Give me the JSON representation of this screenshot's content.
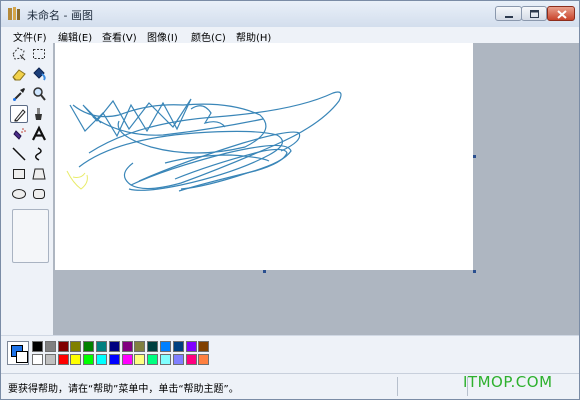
{
  "window": {
    "title": "未命名 - 画图",
    "controls": [
      "minimize-icon",
      "maximize-icon",
      "close-icon"
    ]
  },
  "menu": {
    "items": [
      "文件(F)",
      "编辑(E)",
      "查看(V)",
      "图像(I)",
      "颜色(C)",
      "帮助(H)"
    ]
  },
  "tools": [
    "free-form-select-icon",
    "select-icon",
    "eraser-icon",
    "fill-icon",
    "color-picker-icon",
    "magnifier-icon",
    "pencil-icon",
    "brush-icon",
    "airbrush-icon",
    "text-icon",
    "line-icon",
    "curve-icon",
    "rectangle-icon",
    "polygon-icon",
    "ellipse-icon",
    "rounded-rectangle-icon"
  ],
  "active_tool": "pencil-icon",
  "palette": {
    "foreground": "#1e73e8",
    "background": "#ffffff",
    "top_row": [
      "#000000",
      "#808080",
      "#800000",
      "#808000",
      "#008000",
      "#008080",
      "#000080",
      "#800080",
      "#808040",
      "#004040",
      "#0080ff",
      "#004080",
      "#8000ff",
      "#804000"
    ],
    "bottom_row": [
      "#ffffff",
      "#c0c0c0",
      "#ff0000",
      "#ffff00",
      "#00ff00",
      "#00ffff",
      "#0000ff",
      "#ff00ff",
      "#ffff80",
      "#00ff80",
      "#80ffff",
      "#8080ff",
      "#ff0080",
      "#ff8040"
    ]
  },
  "status": {
    "help_text": "要获得帮助，请在“帮助”菜单中，单击“帮助主题”。"
  },
  "watermark": "ITMOP.COM"
}
